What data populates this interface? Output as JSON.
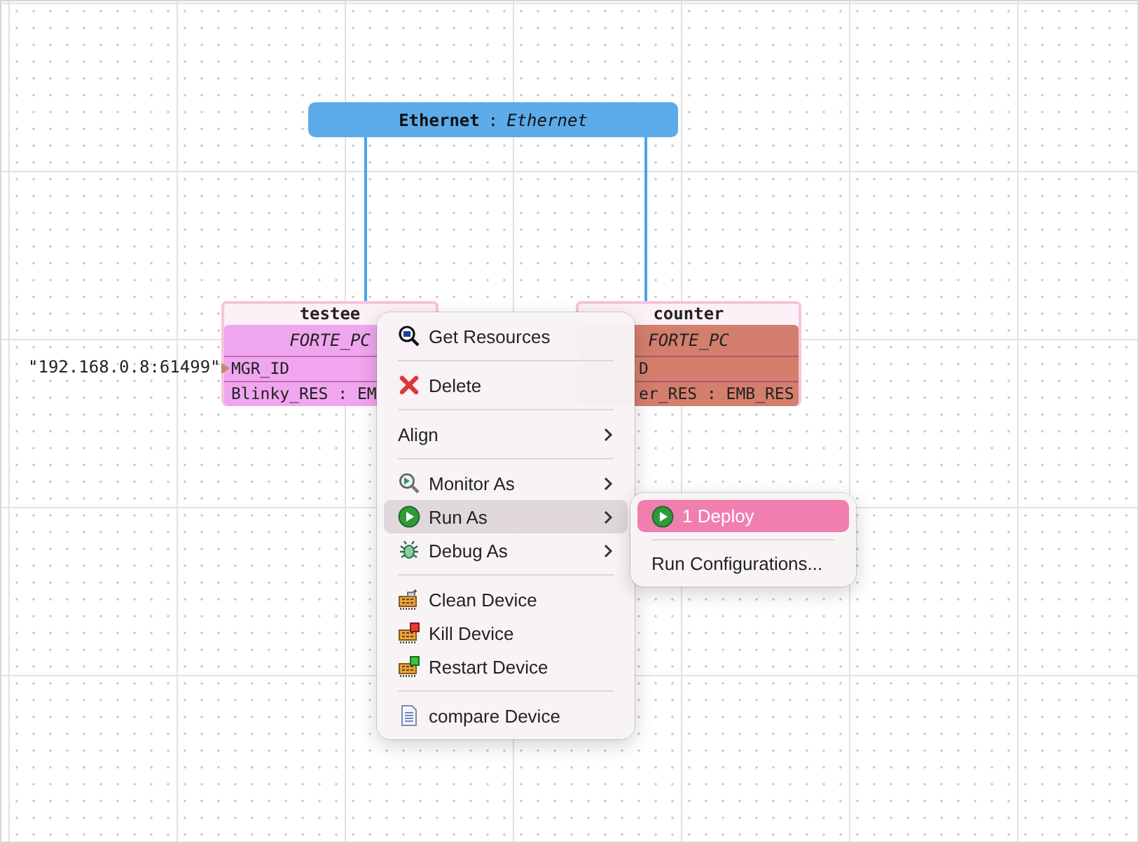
{
  "segment": {
    "name": "Ethernet",
    "separator": ":",
    "type": "Ethernet"
  },
  "devices": [
    {
      "name": "testee",
      "type": "FORTE_PC",
      "rows": [
        "MGR_ID",
        "Blinky_RES : EM"
      ],
      "address": "\"192.168.0.8:61499\""
    },
    {
      "name": "counter",
      "type": "FORTE_PC",
      "rows": [
        "D",
        "er_RES : EMB_RES"
      ]
    }
  ],
  "context_menu": {
    "items": [
      {
        "kind": "item",
        "label": "Get Resources",
        "submenu": false,
        "selected": false
      },
      {
        "kind": "separator"
      },
      {
        "kind": "item",
        "label": "Delete",
        "submenu": false,
        "selected": false
      },
      {
        "kind": "separator"
      },
      {
        "kind": "item",
        "label": "Align",
        "submenu": true,
        "selected": false
      },
      {
        "kind": "separator"
      },
      {
        "kind": "item",
        "label": "Monitor As",
        "submenu": true,
        "selected": false
      },
      {
        "kind": "item",
        "label": "Run As",
        "submenu": true,
        "selected": true
      },
      {
        "kind": "item",
        "label": "Debug As",
        "submenu": true,
        "selected": false
      },
      {
        "kind": "separator"
      },
      {
        "kind": "item",
        "label": "Clean Device",
        "submenu": false,
        "selected": false
      },
      {
        "kind": "item",
        "label": "Kill Device",
        "submenu": false,
        "selected": false
      },
      {
        "kind": "item",
        "label": "Restart Device",
        "submenu": false,
        "selected": false
      },
      {
        "kind": "separator"
      },
      {
        "kind": "item",
        "label": "compare Device",
        "submenu": false,
        "selected": false
      }
    ]
  },
  "submenu": {
    "items": [
      {
        "kind": "item",
        "label": "1 Deploy",
        "selected": true
      },
      {
        "kind": "separator"
      },
      {
        "kind": "item",
        "label": "Run Configurations...",
        "selected": false
      }
    ]
  }
}
